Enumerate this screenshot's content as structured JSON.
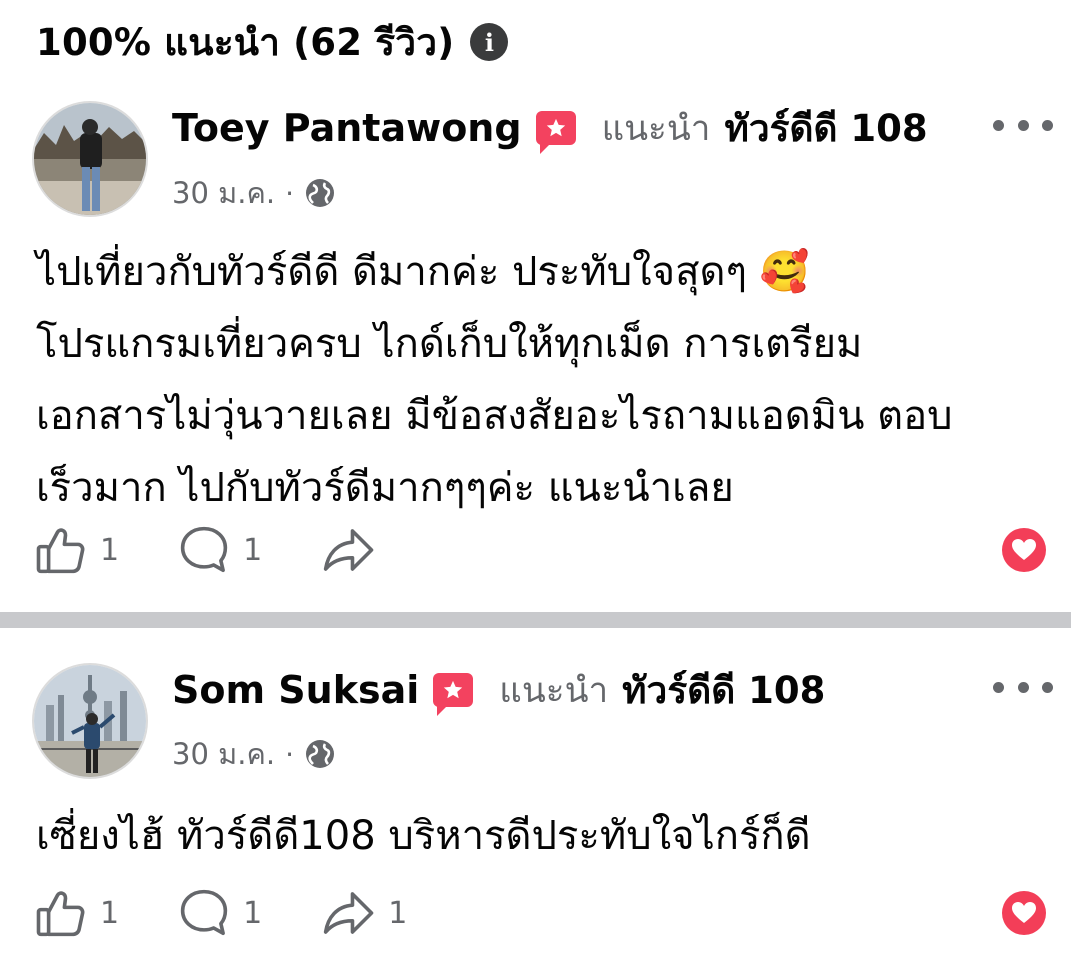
{
  "header": {
    "title": "100% แนะนำ (62 รีวิว)",
    "info_icon": "info-icon"
  },
  "colors": {
    "recommend_badge": "#f3425f",
    "secondary_text": "#65676b",
    "divider": "#c8c9cc"
  },
  "posts": [
    {
      "author": "Toey Pantawong",
      "verb": "แนะนำ",
      "page": "ทัวร์ดีดี 108",
      "date": "30 ม.ค.",
      "separator": "·",
      "privacy_icon": "globe-icon",
      "text": "ไปเที่ยวกับทัวร์ดีดี ดีมากค่ะ ประทับใจสุดๆ 🥰\nโปรแกรมเที่ยวครบ ไกด์เก็บให้ทุกเม็ด การเตรียม\nเอกสารไม่วุ่นวายเลย มีข้อสงสัยอะไรถามแอดมิน ตอบ\nเร็วมาก ไปกับทัวร์ดีมากๆๆค่ะ แนะนำเลย",
      "like_count": "1",
      "comment_count": "1",
      "share_count": ""
    },
    {
      "author": "Som Suksai",
      "verb": "แนะนำ",
      "page": "ทัวร์ดีดี 108",
      "date": "30 ม.ค.",
      "separator": "·",
      "privacy_icon": "globe-icon",
      "text": "เซี่ยงไฮ้ ทัวร์ดีดี108 บริหารดีประทับใจไกร์ก็ดี",
      "like_count": "1",
      "comment_count": "1",
      "share_count": "1"
    }
  ]
}
